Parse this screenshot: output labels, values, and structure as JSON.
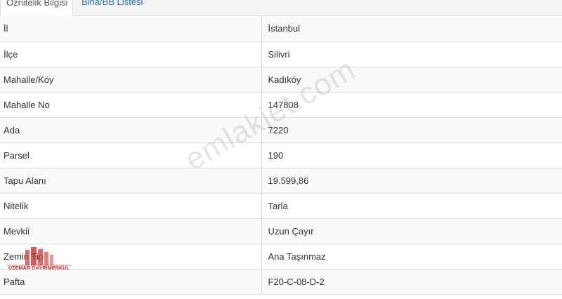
{
  "tabs": [
    {
      "label": "Öznitelik Bilgisi",
      "active": true
    },
    {
      "label": "Bina/BB Listesi",
      "active": false
    }
  ],
  "rows": [
    {
      "key": "İl",
      "value": "İstanbul"
    },
    {
      "key": "İlçe",
      "value": "Silivri"
    },
    {
      "key": "Mahalle/Köy",
      "value": "Kadıköy"
    },
    {
      "key": "Mahalle No",
      "value": "147808"
    },
    {
      "key": "Ada",
      "value": "7220"
    },
    {
      "key": "Parsel",
      "value": "190"
    },
    {
      "key": "Tapu Alanı",
      "value": "19.599,86"
    },
    {
      "key": "Nitelik",
      "value": "Tarla"
    },
    {
      "key": "Mevkii",
      "value": "Uzun Çayır"
    },
    {
      "key": "Zemin Tip",
      "value": "Ana Taşınmaz"
    },
    {
      "key": "Pafta",
      "value": "F20-C-08-D-2"
    }
  ],
  "watermark": "emlakjet.com",
  "agent_logo_text": "UZEMAR GAYRİMENKUL",
  "colors": {
    "link": "#2a7ab0",
    "border": "#dddddd",
    "stripe": "#f9f9f9",
    "logo": "#cc2222"
  }
}
